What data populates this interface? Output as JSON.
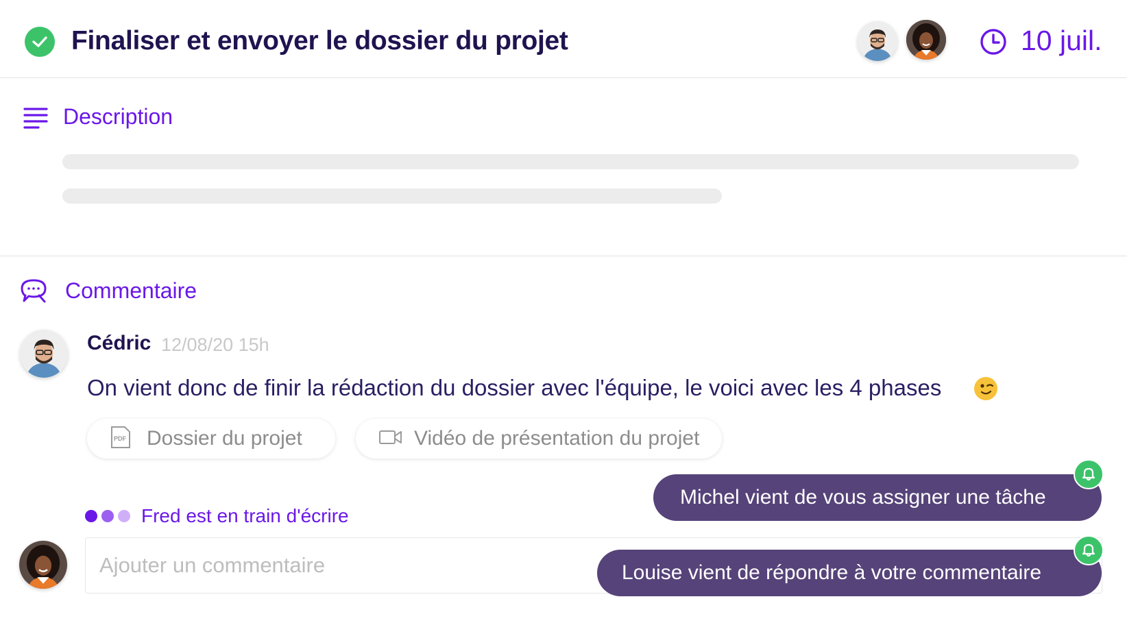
{
  "task": {
    "title": "Finaliser et envoyer le dossier du projet",
    "due_date": "10 juil.",
    "status_color": "#3cc36a"
  },
  "description": {
    "heading": "Description"
  },
  "comments_section": {
    "heading": "Commentaire",
    "comment": {
      "author": "Cédric",
      "timestamp": "12/08/20 15h",
      "text": "On vient donc de finir la rédaction du dossier avec l'équipe, le voici avec les 4 phases",
      "emoji": "wink-emoji",
      "attachments": [
        {
          "label": "Dossier du projet",
          "icon": "pdf-file-icon"
        },
        {
          "label": "Vidéo de présentation du projet",
          "icon": "video-camera-icon"
        }
      ]
    },
    "typing_indicator": {
      "user": "Fred",
      "text": "est en train d'écrire"
    },
    "input": {
      "placeholder": "Ajouter un commentaire",
      "value": ""
    }
  },
  "notifications": [
    {
      "text": "Michel vient de vous assigner une tâche",
      "icon": "bell-icon"
    },
    {
      "text": "Louise vient de répondre à votre commentaire",
      "icon": "bell-icon"
    }
  ],
  "colors": {
    "accent": "#6a17e8",
    "title": "#1f1350",
    "toast_bg": "#564379",
    "success": "#3cc36a"
  }
}
